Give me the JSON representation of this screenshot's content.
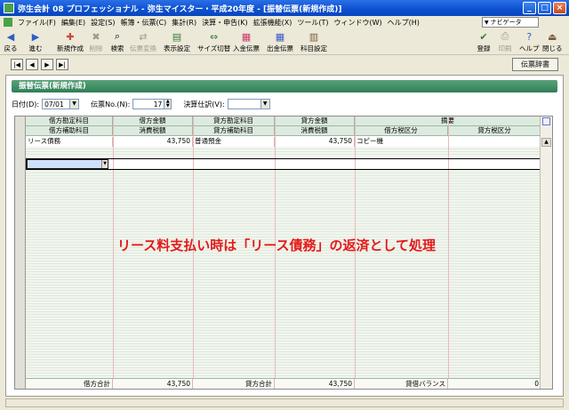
{
  "window": {
    "title": "弥生会計 08 プロフェッショナル - 弥生マイスター・平成20年度 - [振替伝票(新規作成)]",
    "controls": [
      "_",
      "□",
      "×"
    ]
  },
  "menu": {
    "items": [
      "ファイル(F)",
      "編集(E)",
      "設定(S)",
      "帳簿・伝票(C)",
      "集計(R)",
      "決算・申告(K)",
      "拡張機能(X)",
      "ツール(T)",
      "ウィンドウ(W)",
      "ヘルプ(H)"
    ],
    "navi_label": "ナビゲータ"
  },
  "toolbar": {
    "back": "戻る",
    "forward": "進む",
    "new": "新規作成",
    "delete": "削除",
    "search": "検索",
    "disabled_item": "伝票変換",
    "display": "表示設定",
    "resize": "サイズ切替",
    "receipt": "入金伝票",
    "payment": "出金伝票",
    "account_settings": "科目設定",
    "register": "登録",
    "print": "印刷",
    "help": "ヘルプ",
    "close": "閉じる"
  },
  "nav": {
    "first": "|◀",
    "prev": "◀",
    "next": "▶",
    "last": "▶|",
    "dictionary": "伝票辞書"
  },
  "panel": {
    "section_title": "振替伝票(新規作成)"
  },
  "form": {
    "date_label": "日付(D):",
    "date_value": "07/01",
    "slip_no_label": "伝票No.(N):",
    "slip_no_value": "17",
    "closing_label": "決算仕訳(V):",
    "closing_value": ""
  },
  "grid": {
    "headers_top": [
      "借方勘定科目",
      "借方金額",
      "貸方勘定科目",
      "貸方金額",
      "摘要"
    ],
    "headers_bottom": [
      "借方補助科目",
      "消費税額",
      "貸方補助科目",
      "消費税額",
      "借方税区分",
      "貸方税区分"
    ],
    "rows": [
      {
        "debit_account": "リース債務",
        "debit_amount": "43,750",
        "credit_account": "普通預金",
        "credit_amount": "43,750",
        "memo": "コピー機"
      }
    ],
    "footer": {
      "debit_total_label": "借方合計",
      "debit_total": "43,750",
      "credit_total_label": "貸方合計",
      "credit_total": "43,750",
      "balance_label": "貸借バランス",
      "balance": "0"
    }
  },
  "annotation": "リース料支払い時は「リース債務」の返済として処理"
}
